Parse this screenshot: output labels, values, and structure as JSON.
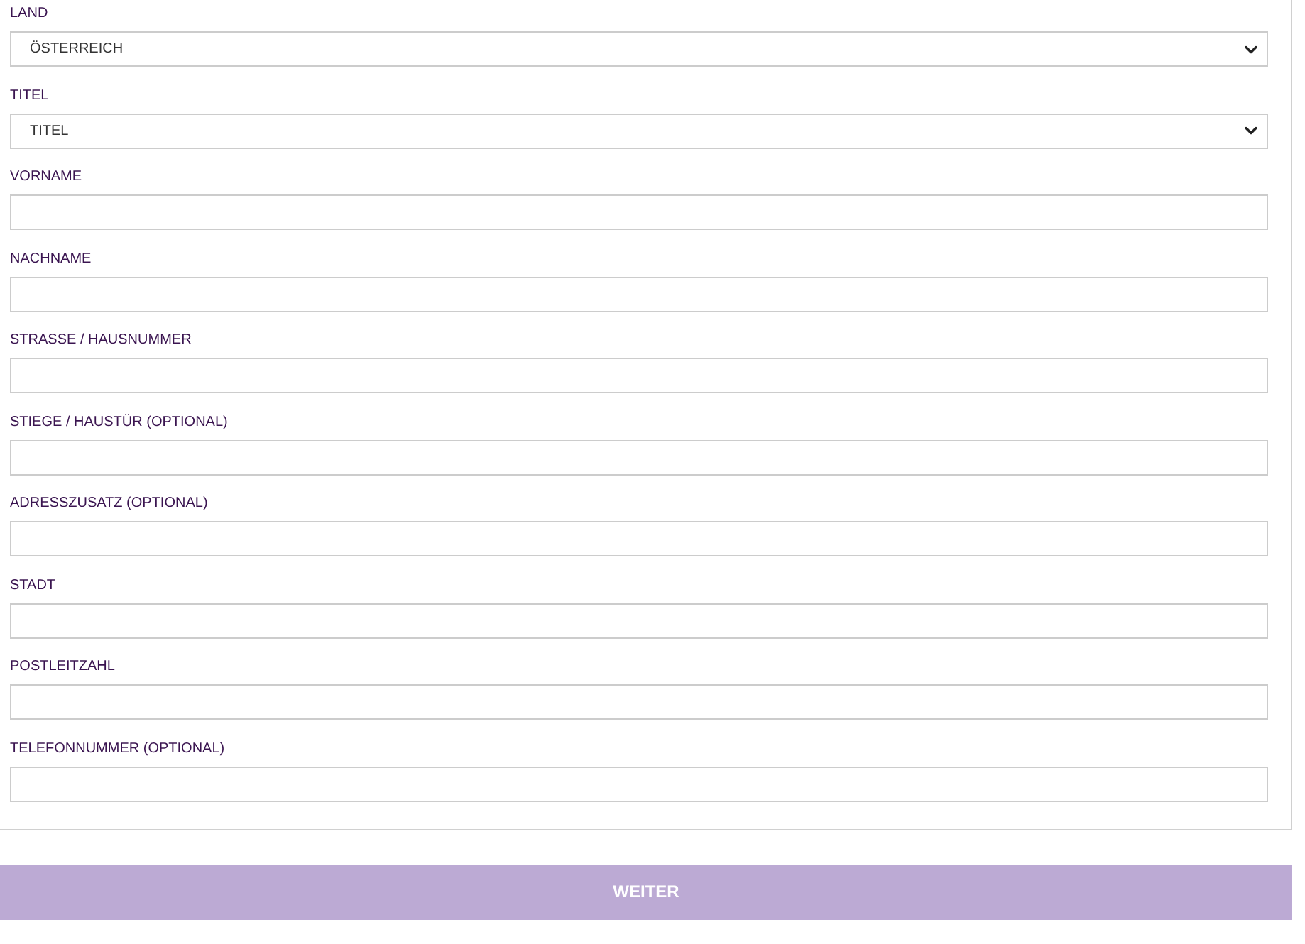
{
  "fields": [
    {
      "label": "LAND",
      "kind": "select",
      "value": "ÖSTERREICH"
    },
    {
      "label": "TITEL",
      "kind": "select",
      "value": "TITEL"
    },
    {
      "label": "VORNAME",
      "kind": "text"
    },
    {
      "label": "NACHNAME",
      "kind": "text"
    },
    {
      "label": "STRASSE / HAUSNUMMER",
      "kind": "text"
    },
    {
      "label": "STIEGE / HAUSTÜR (OPTIONAL)",
      "kind": "text"
    },
    {
      "label": "ADRESSZUSATZ (OPTIONAL)",
      "kind": "text"
    },
    {
      "label": "STADT",
      "kind": "text"
    },
    {
      "label": "POSTLEITZAHL",
      "kind": "text"
    },
    {
      "label": "TELEFONNUMMER (OPTIONAL)",
      "kind": "text"
    }
  ],
  "submit_button": "WEITER"
}
